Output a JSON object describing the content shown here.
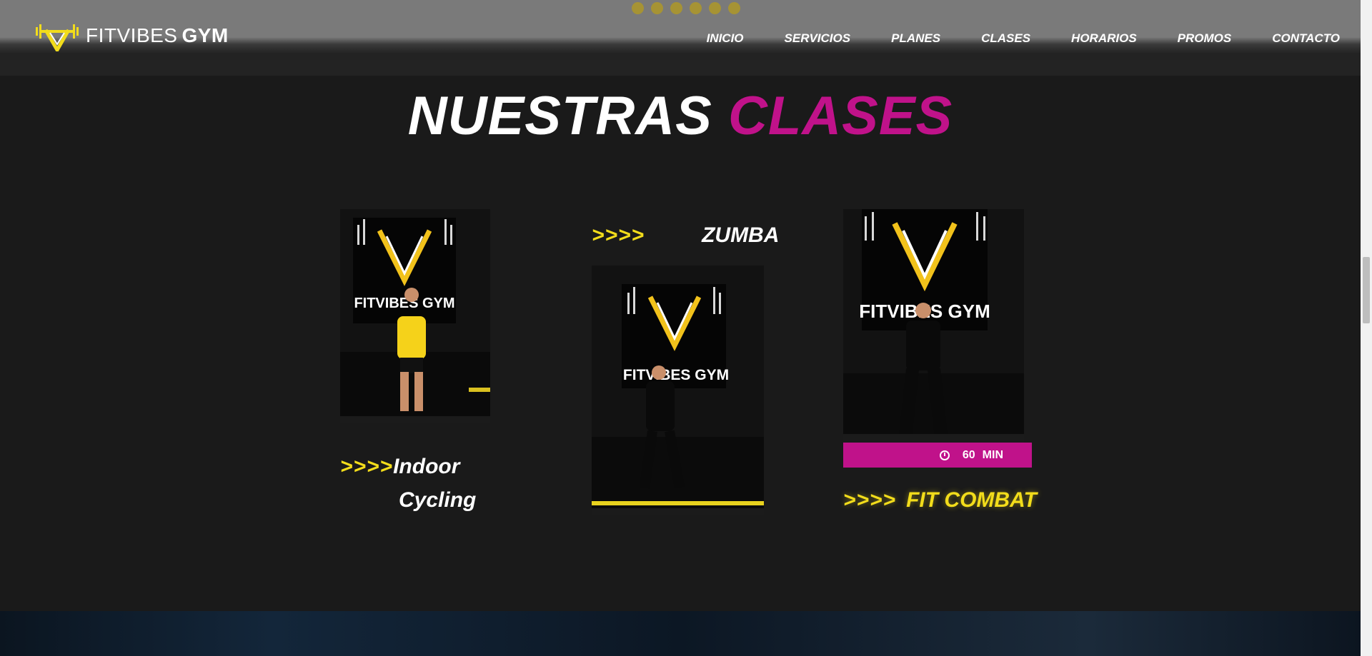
{
  "header": {
    "logo": {
      "text_light": "FITVIBES",
      "text_bold": "GYM",
      "icon": "dumbbell-v-logo-icon"
    },
    "rating_stars": 6,
    "nav": [
      {
        "label": "INICIO"
      },
      {
        "label": "SERVICIOS"
      },
      {
        "label": "PLANES"
      },
      {
        "label": "CLASES"
      },
      {
        "label": "HORARIOS"
      },
      {
        "label": "PROMOS"
      },
      {
        "label": "CONTACTO"
      }
    ]
  },
  "section": {
    "title_white": "NUESTRAS",
    "title_pink": "CLASES"
  },
  "classes": [
    {
      "arrows": ">>>>",
      "name_line1": "Indoor",
      "name_line2": "Cycling",
      "photo_text": "FITVIBES GYM"
    },
    {
      "arrows": ">>>>",
      "name": "ZUMBA",
      "photo_text": "FITVIBES GYM"
    },
    {
      "arrows": ">>>>",
      "name": "FIT COMBAT",
      "photo_text": "FITVIBES GYM",
      "duration_value": "60",
      "duration_unit": "MIN"
    }
  ],
  "colors": {
    "accent_pink": "#c0128a",
    "accent_yellow": "#f2dc1b",
    "background": "#1a1a1a"
  }
}
